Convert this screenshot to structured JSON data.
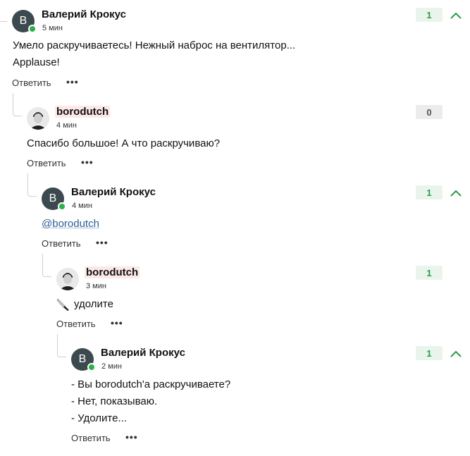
{
  "comments": [
    {
      "avatar_letter": "B",
      "author": "Валерий Крокус",
      "time": "5 мин",
      "lines": [
        "Умело раскручиваетесь! Нежный наброс на вентилятор...",
        "Applause!"
      ],
      "reply_label": "Ответить",
      "more_label": "•••",
      "score": "1",
      "upvote_icon": "chevron-up-icon"
    },
    {
      "author": "borodutch",
      "time": "4 мин",
      "lines": [
        "Спасибо большое! А что раскручиваю?"
      ],
      "reply_label": "Ответить",
      "more_label": "•••",
      "score": "0"
    },
    {
      "avatar_letter": "B",
      "author": "Валерий Крокус",
      "time": "4 мин",
      "mention": "@borodutch",
      "reply_label": "Ответить",
      "more_label": "•••",
      "score": "1",
      "upvote_icon": "chevron-up-icon"
    },
    {
      "author": "borodutch",
      "time": "3 мин",
      "emoji": "🔪",
      "lines": [
        "удолите"
      ],
      "reply_label": "Ответить",
      "more_label": "•••",
      "score": "1"
    },
    {
      "avatar_letter": "B",
      "author": "Валерий Крокус",
      "time": "2 мин",
      "lines": [
        "- Вы borodutch'а раскручиваете?",
        "- Нет, показываю.",
        "- Удолите..."
      ],
      "reply_label": "Ответить",
      "more_label": "•••",
      "score": "1",
      "upvote_icon": "chevron-up-icon"
    }
  ],
  "colors": {
    "score_positive_bg": "#e9f5ec",
    "score_positive_text": "#2e9a48",
    "score_zero_bg": "#ececec",
    "online": "#2bb04a",
    "avatar_bg": "#3c4a4f",
    "mention": "#2d5f94",
    "author_highlight": "#fde8e8"
  }
}
